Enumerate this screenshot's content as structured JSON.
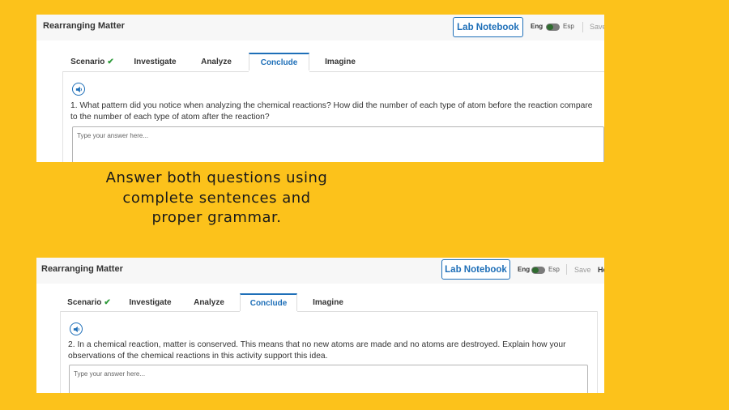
{
  "caption": "Answer both questions using complete sentences and proper grammar.",
  "panels": [
    {
      "title": "Rearranging Matter",
      "lab_notebook": "Lab Notebook",
      "lang_eng": "Eng",
      "lang_esp": "Esp",
      "save": "Save",
      "help": "",
      "tabs": [
        {
          "label": "Scenario",
          "completed": true
        },
        {
          "label": "Investigate"
        },
        {
          "label": "Analyze"
        },
        {
          "label": "Conclude",
          "active": true
        },
        {
          "label": "Imagine"
        }
      ],
      "question": "1. What pattern did you notice when analyzing the chemical reactions? How did the number of each type of atom before the reaction compare to the number of each type of atom after the reaction?",
      "answer_placeholder": "Type your answer here..."
    },
    {
      "title": "Rearranging Matter",
      "lab_notebook": "Lab Notebook",
      "lang_eng": "Eng",
      "lang_esp": "Esp",
      "save": "Save",
      "help": "He",
      "tabs": [
        {
          "label": "Scenario",
          "completed": true
        },
        {
          "label": "Investigate"
        },
        {
          "label": "Analyze"
        },
        {
          "label": "Conclude",
          "active": true
        },
        {
          "label": "Imagine"
        }
      ],
      "question": "2. In a chemical reaction, matter is conserved. This means that no new atoms are made and no atoms are destroyed. Explain how your observations of the chemical reactions in this activity support this idea.",
      "answer_placeholder": "Type your answer here..."
    }
  ],
  "colors": {
    "background": "#fcc21b",
    "accent": "#1e6fb8",
    "check": "#2e9a3a"
  },
  "icons": {
    "audio": "speaker-icon",
    "check": "checkmark-icon"
  }
}
